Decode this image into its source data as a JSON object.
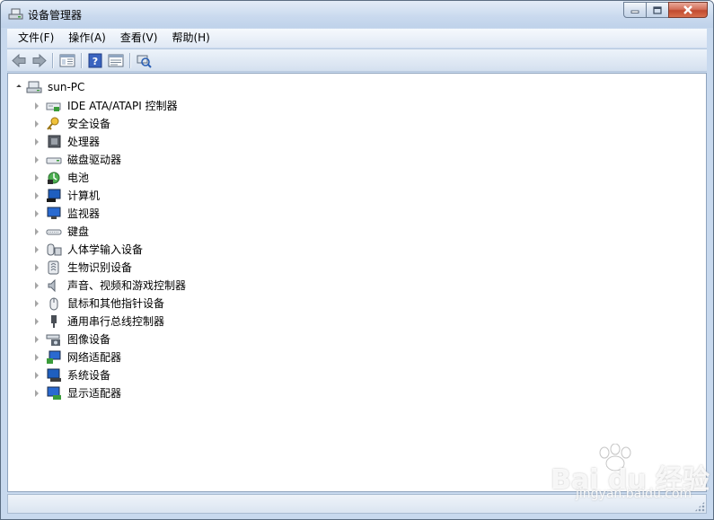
{
  "window": {
    "title": "设备管理器"
  },
  "menu": [
    {
      "id": "file",
      "label": "文件(F)"
    },
    {
      "id": "action",
      "label": "操作(A)"
    },
    {
      "id": "view",
      "label": "查看(V)"
    },
    {
      "id": "help",
      "label": "帮助(H)"
    }
  ],
  "toolbar": {
    "buttons": [
      "back-icon",
      "forward-icon",
      "show-hide-console-tree-icon",
      "help-icon",
      "properties-icon",
      "scan-hardware-icon"
    ]
  },
  "tree": {
    "root": "sun-PC",
    "items": [
      {
        "label": "IDE ATA/ATAPI 控制器",
        "icon": "ide-controller-icon"
      },
      {
        "label": "安全设备",
        "icon": "security-device-icon"
      },
      {
        "label": "处理器",
        "icon": "processor-icon"
      },
      {
        "label": "磁盘驱动器",
        "icon": "disk-drive-icon"
      },
      {
        "label": "电池",
        "icon": "battery-icon"
      },
      {
        "label": "计算机",
        "icon": "computer-icon"
      },
      {
        "label": "监视器",
        "icon": "monitor-icon"
      },
      {
        "label": "键盘",
        "icon": "keyboard-icon"
      },
      {
        "label": "人体学输入设备",
        "icon": "hid-icon"
      },
      {
        "label": "生物识别设备",
        "icon": "biometric-icon"
      },
      {
        "label": "声音、视频和游戏控制器",
        "icon": "sound-icon"
      },
      {
        "label": "鼠标和其他指针设备",
        "icon": "mouse-icon"
      },
      {
        "label": "通用串行总线控制器",
        "icon": "usb-icon"
      },
      {
        "label": "图像设备",
        "icon": "imaging-device-icon"
      },
      {
        "label": "网络适配器",
        "icon": "network-adapter-icon"
      },
      {
        "label": "系统设备",
        "icon": "system-device-icon"
      },
      {
        "label": "显示适配器",
        "icon": "display-adapter-icon"
      }
    ]
  },
  "watermark": {
    "brand": "Bai du 经验",
    "url": "jingyan.baidu.com"
  }
}
